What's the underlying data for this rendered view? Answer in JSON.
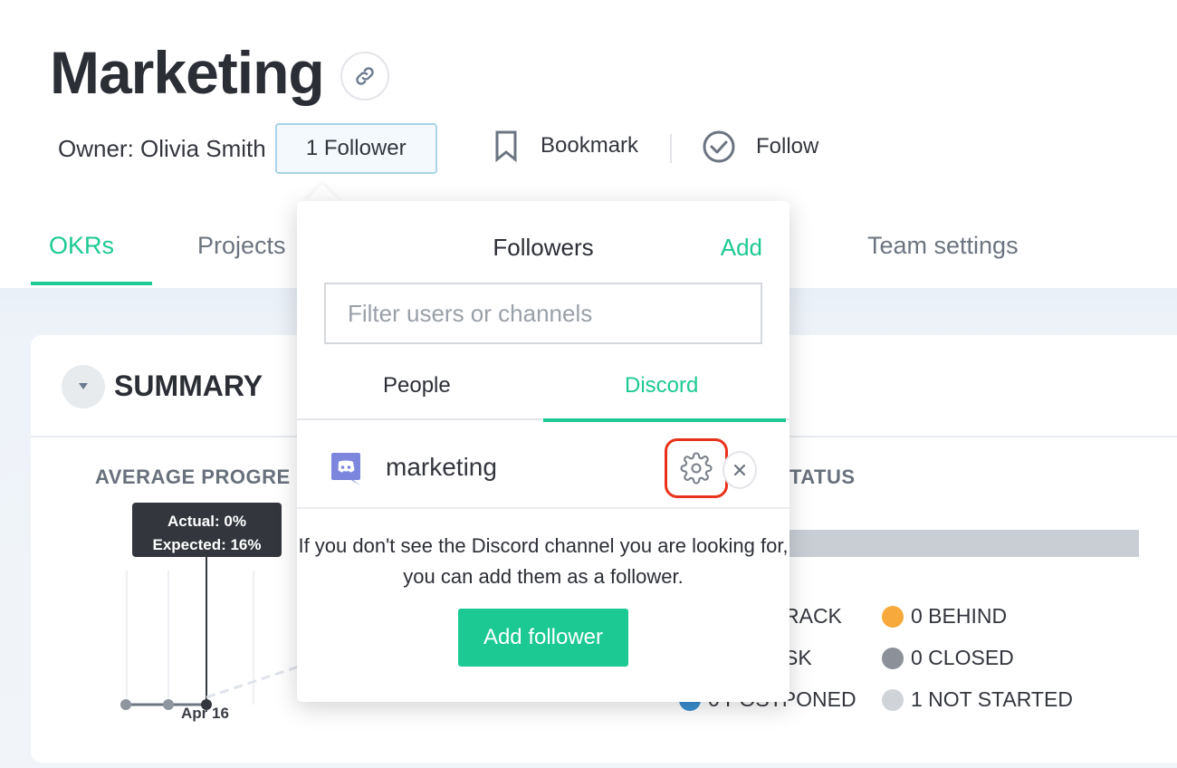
{
  "header": {
    "title": "Marketing",
    "owner": "Owner: Olivia Smith",
    "follower_button": "1 Follower",
    "bookmark_label": "Bookmark",
    "follow_label": "Follow"
  },
  "tabs": [
    {
      "label": "OKRs",
      "active": true
    },
    {
      "label": "Projects",
      "active": false
    },
    {
      "label": "Team settings",
      "active": false
    }
  ],
  "summary": {
    "title": "SUMMARY",
    "average_progress_title": "AVERAGE PROGRE",
    "status_title": "TATUS",
    "tooltip": {
      "actual": "Actual: 0%",
      "expected": "Expected: 16%"
    },
    "x_label": "Apr 16"
  },
  "legend": [
    {
      "label": "RACK",
      "color": null
    },
    {
      "label": "0 BEHIND",
      "color": "#f7a93b"
    },
    {
      "label": "SK",
      "color": null
    },
    {
      "label": "0 CLOSED",
      "color": "#8b9099"
    },
    {
      "label": "0 POSTPONED",
      "color": "#3a8fd0"
    },
    {
      "label": "1 NOT STARTED",
      "color": "#d0d3d8"
    }
  ],
  "popover": {
    "title": "Followers",
    "add_label": "Add",
    "filter_placeholder": "Filter users or channels",
    "tabs": [
      {
        "label": "People",
        "active": false
      },
      {
        "label": "Discord",
        "active": true
      }
    ],
    "channels": [
      {
        "name": "marketing",
        "icon": "discord-icon"
      }
    ],
    "message": "If you don't see the Discord channel you are looking for, you can add them as a follower.",
    "add_follower_button": "Add follower"
  },
  "colors": {
    "accent": "#1dc993",
    "highlight": "#e8321b",
    "discord": "#7c86dd"
  }
}
